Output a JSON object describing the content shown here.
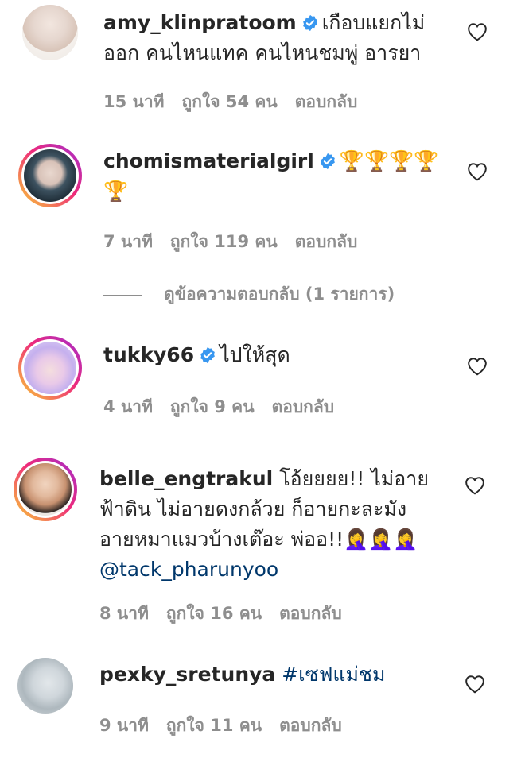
{
  "comments": [
    {
      "username": "amy_klinpratoom",
      "text_line1": "เกือบแยกไม่",
      "text_line2": "ออก คนไหนแทค คนไหนชมพู่ อารยา",
      "time": "15 นาที",
      "likes": "ถูกใจ 54 คน",
      "reply": "ตอบกลับ",
      "verified": true
    },
    {
      "username": "chomismaterialgirl",
      "text_line1": "🏆🏆🏆🏆",
      "text_line2": "🏆",
      "time": "7 นาที",
      "likes": "ถูกใจ 119 คน",
      "reply": "ตอบกลับ",
      "verified": true,
      "view_replies": "ดูข้อความตอบกลับ (1 รายการ)"
    },
    {
      "username": "tukky66",
      "text_line1": "ไปให้สุด",
      "time": "4 นาที",
      "likes": "ถูกใจ 9 คน",
      "reply": "ตอบกลับ",
      "verified": true
    },
    {
      "username": "belle_engtrakul",
      "text_line1": "โอ้ยยยย!! ไม่อาย",
      "text_line2": "ฟ้าดิน ไม่อายดงกล้วย ก็อายกะละมัง",
      "text_line3": "อายหมาแมวบ้างเต๊อะ พ่ออ!!🤦‍♀️🤦‍♀️🤦‍♀️",
      "mention": "@tack_pharunyoo",
      "time": "8 นาที",
      "likes": "ถูกใจ 16 คน",
      "reply": "ตอบกลับ",
      "verified": false
    },
    {
      "username": "pexky_sretunya",
      "hashtag": "#เซฟแม่ชม",
      "time": "9 นาที",
      "likes": "ถูกใจ 11 คน",
      "reply": "ตอบกลับ",
      "verified": false
    }
  ],
  "colors": {
    "text": "#262626",
    "meta": "#8e8e8e",
    "verified": "#3897f0",
    "link": "#00376b"
  },
  "icons": {
    "like": "heart-outline-icon",
    "verified": "verified-badge-icon"
  }
}
